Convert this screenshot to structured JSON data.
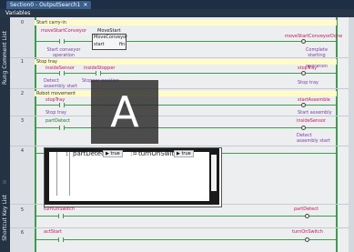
{
  "window": {
    "tab_title": "Section0 - OutputSearch1",
    "close_glyph": "✕"
  },
  "variables_label": "Variables",
  "side_panels": {
    "rung_comment_list": "Rung Comment List",
    "shortcut_key_list": "Shortcut Key List"
  },
  "rungs": [
    {
      "number": "0",
      "comment": "Start carry-in",
      "contact": {
        "name": "moveStartConveyor",
        "comment": "Start conveyor operation"
      },
      "fb": {
        "instance": "MoveStart",
        "type": "MoveConveyor",
        "in_pin": "start",
        "out_pin": "fin"
      },
      "coil": {
        "name": "moveStartConveyorDone",
        "comment": "Complete starting conveyor operation"
      }
    },
    {
      "number": "1",
      "comment": "Stop tray",
      "contacts": [
        {
          "name": "insideSensor",
          "comment": "Detect assembly start"
        },
        {
          "name": "insideStopper",
          "comment": "Stopper position"
        }
      ],
      "coil": {
        "name": "stopTray",
        "comment": "Stop tray"
      }
    },
    {
      "number": "2",
      "comment": "Robot movement",
      "contact": {
        "name": "stopTray",
        "comment": "Stop tray"
      },
      "coil": {
        "name": "startAssemble",
        "comment": "Start assembly"
      }
    },
    {
      "number": "3",
      "contact": {
        "name": "partDetect"
      },
      "coil": {
        "name": "insideSensor",
        "comment": "Detect assembly start"
      }
    },
    {
      "number": "4",
      "st": {
        "line_no": "1",
        "target": "partDetect",
        "assign": ":=",
        "source": "turnOnSwitch",
        "value_a": "true",
        "value_b": "true"
      }
    },
    {
      "number": "5",
      "contact": {
        "name": "turnOnSwitch"
      },
      "coil": {
        "name": "partDetect"
      }
    },
    {
      "number": "6",
      "contact": {
        "name": "actStart"
      },
      "coil": {
        "name": "turnOnSwitch"
      }
    }
  ],
  "overlay": {
    "letter": "A"
  },
  "colors": {
    "rail": "#3d9a4f",
    "comment_bg": "#fffcc8",
    "titlebar": "#1e2f45",
    "accent": "#3a5f8c"
  },
  "icons": {
    "play": "▶"
  }
}
